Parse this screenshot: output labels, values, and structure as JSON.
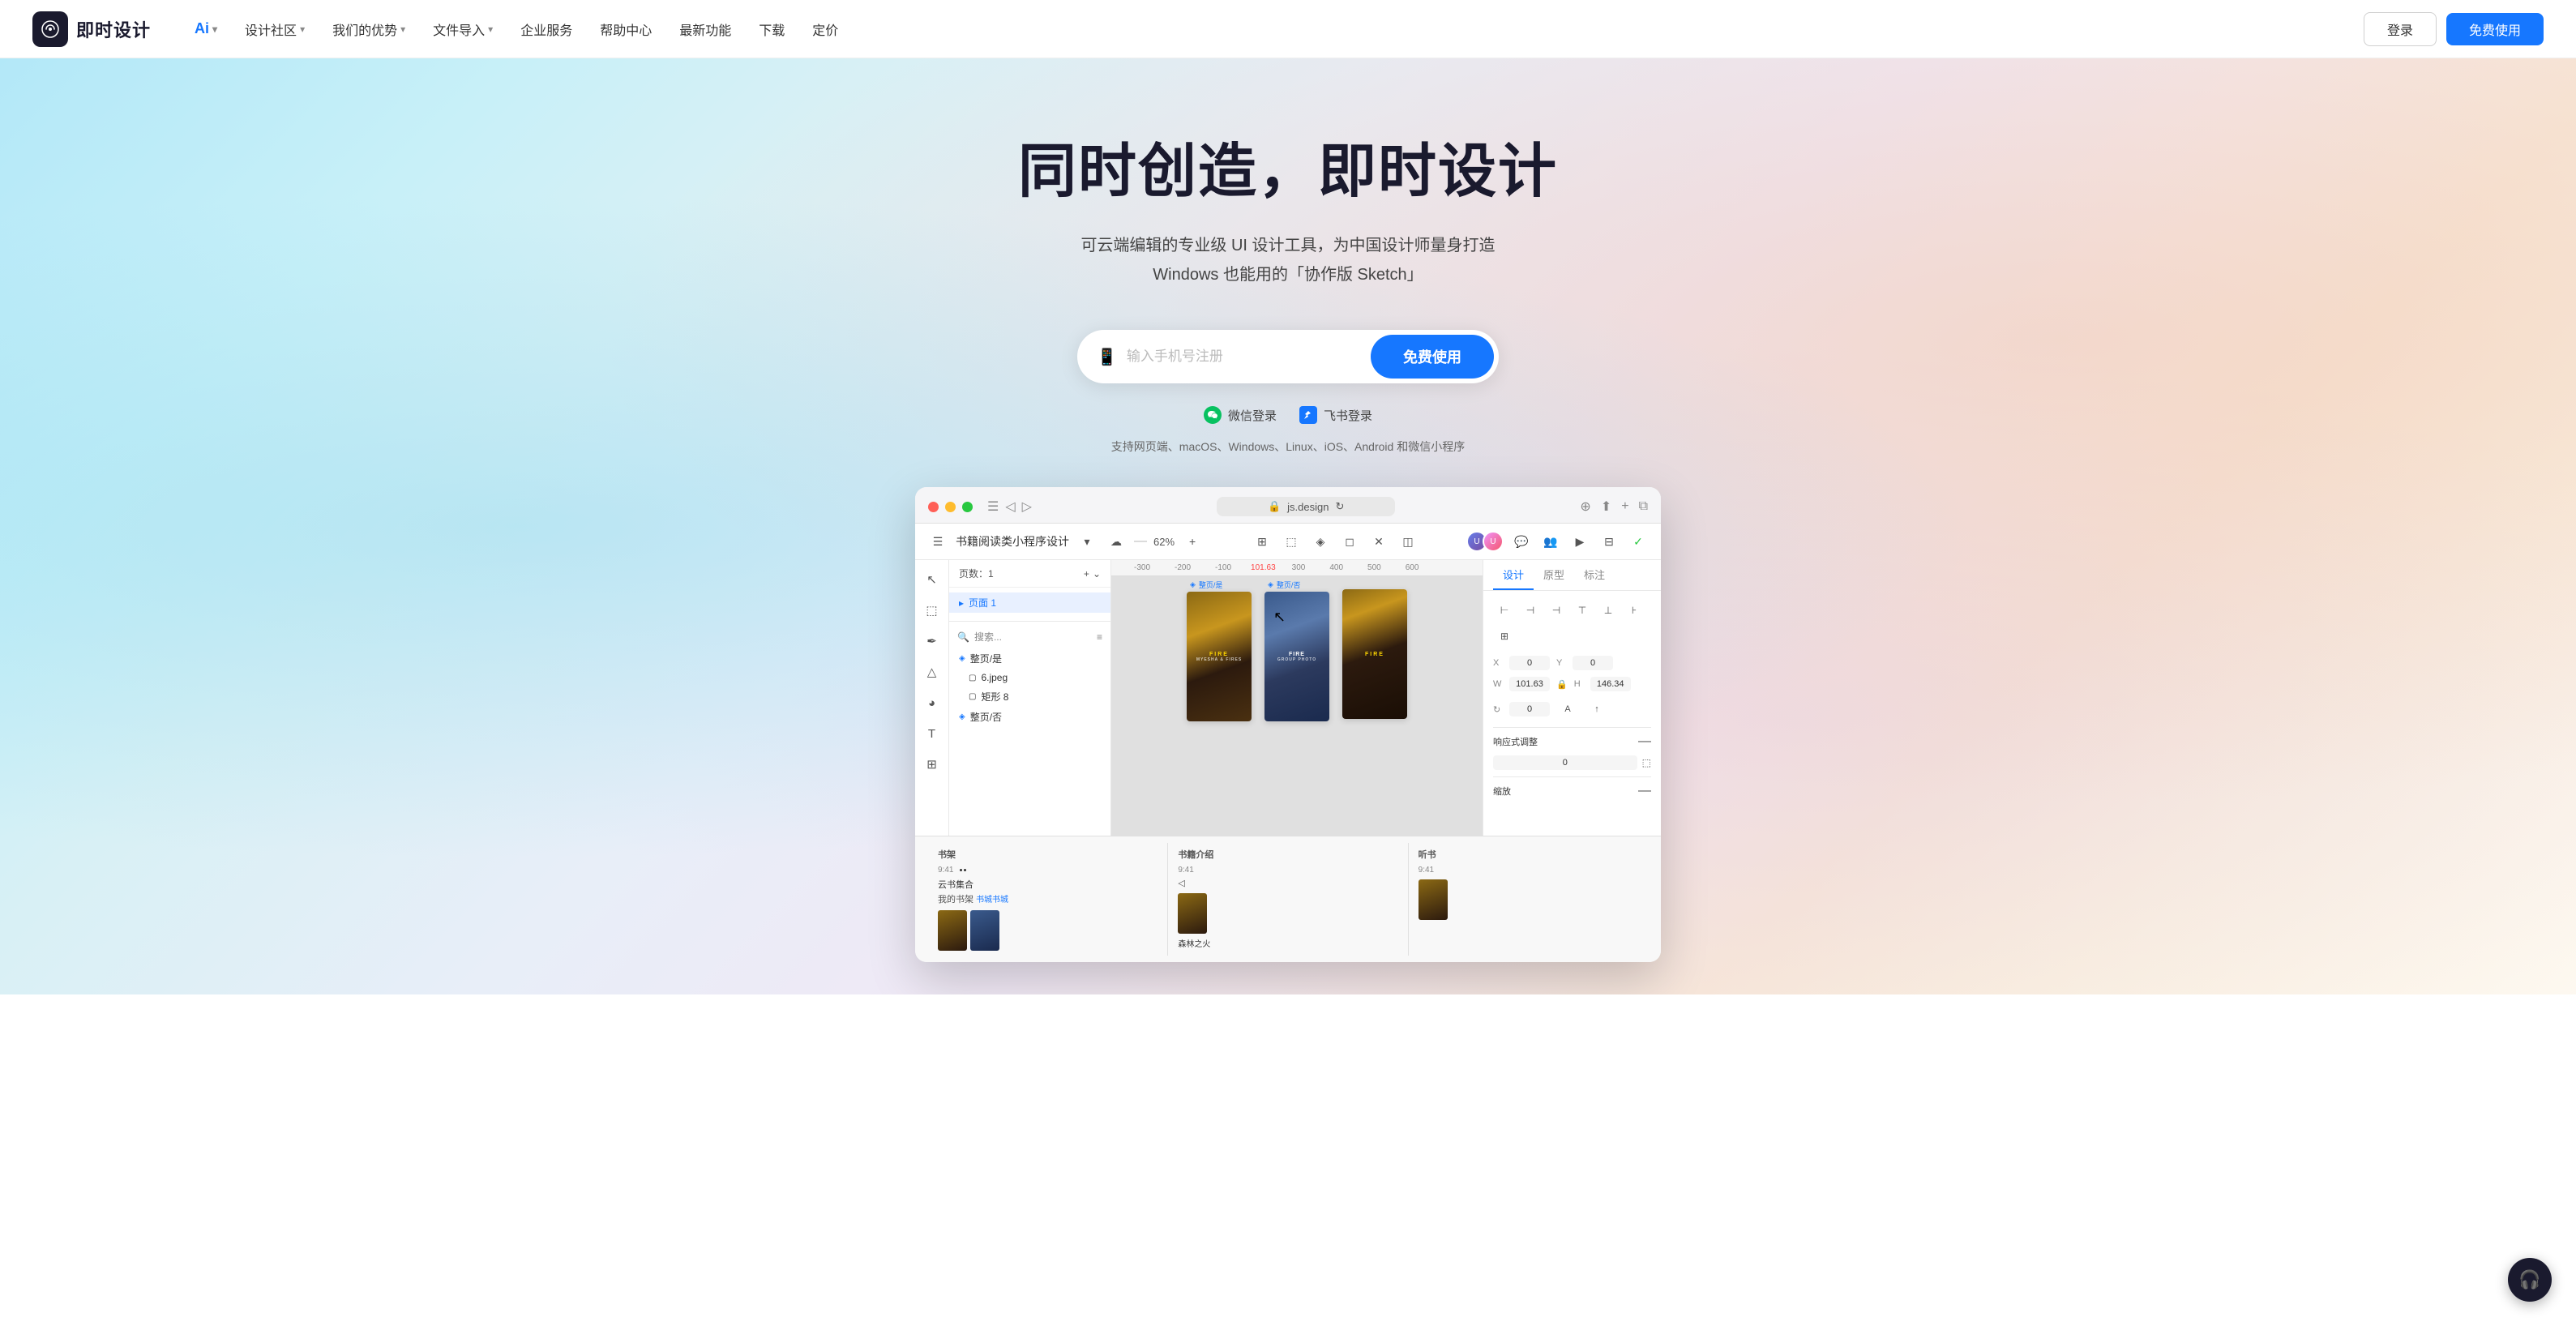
{
  "brand": {
    "name": "即时设计",
    "logo_alt": "即时设计 logo"
  },
  "navbar": {
    "ai_label": "Ai",
    "items": [
      {
        "label": "设计社区",
        "has_dropdown": true
      },
      {
        "label": "我们的优势",
        "has_dropdown": true
      },
      {
        "label": "文件导入",
        "has_dropdown": true
      },
      {
        "label": "企业服务",
        "has_dropdown": false
      },
      {
        "label": "帮助中心",
        "has_dropdown": false
      },
      {
        "label": "最新功能",
        "has_dropdown": false
      },
      {
        "label": "下载",
        "has_dropdown": false
      },
      {
        "label": "定价",
        "has_dropdown": false
      }
    ],
    "login_label": "登录",
    "free_label": "免费使用"
  },
  "hero": {
    "title": "同时创造，即时设计",
    "subtitle_line1": "可云端编辑的专业级 UI 设计工具，为中国设计师量身打造",
    "subtitle_line2": "Windows 也能用的「协作版 Sketch」",
    "input_placeholder": "输入手机号注册",
    "cta_button": "免费使用",
    "wechat_login": "微信登录",
    "feishu_login": "飞书登录",
    "platform_support": "支持网页端、macOS、Windows、Linux、iOS、Android 和微信小程序"
  },
  "app_screenshot": {
    "url": "js.design",
    "project_name": "书籍阅读类小程序设计",
    "zoom": "62%",
    "tabs": {
      "design": "设计",
      "prototype": "原型",
      "mark": "标注"
    },
    "layers": {
      "pages_label": "页数：1",
      "page1": "页面 1",
      "layer1": "整页/是",
      "layer2": "6.jpeg",
      "layer3": "矩形 8",
      "layer4": "整页/否"
    },
    "search_placeholder": "搜索...",
    "properties": {
      "x_label": "X",
      "x_value": "0",
      "y_label": "Y",
      "y_value": "0",
      "w_label": "W",
      "w_value": "101.63",
      "h_label": "H",
      "h_value": "146.34",
      "rotation_label": "C",
      "rotation_value": "0",
      "responsive_label": "响应式调整",
      "scale_label": "缩放"
    },
    "bottom_sections": {
      "bookshelf_title": "书架",
      "intro_title": "书籍介绍",
      "audiobook_title": "听书"
    }
  },
  "float_button": {
    "icon": "🎧",
    "label": "support"
  }
}
